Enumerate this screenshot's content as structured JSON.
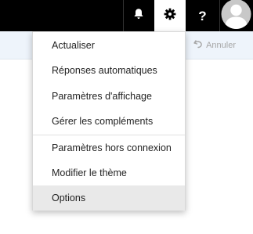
{
  "topbar": {
    "icons": [
      "bell-icon",
      "gear-icon",
      "help-icon",
      "avatar-icon"
    ],
    "help_label": "?"
  },
  "toolbar": {
    "undo_label": "Annuler"
  },
  "settings_menu": {
    "items": [
      {
        "label": "Actualiser"
      },
      {
        "label": "Réponses automatiques"
      },
      {
        "label": "Paramètres d'affichage"
      },
      {
        "label": "Gérer les compléments"
      },
      {
        "label": "Paramètres hors connexion"
      },
      {
        "label": "Modifier le thème"
      },
      {
        "label": "Options"
      }
    ],
    "highlighted_item": "Options"
  },
  "colors": {
    "topbar_bg": "#000000",
    "subbar_bg": "#eef4fb",
    "menu_highlight": "#e9e9e9"
  }
}
